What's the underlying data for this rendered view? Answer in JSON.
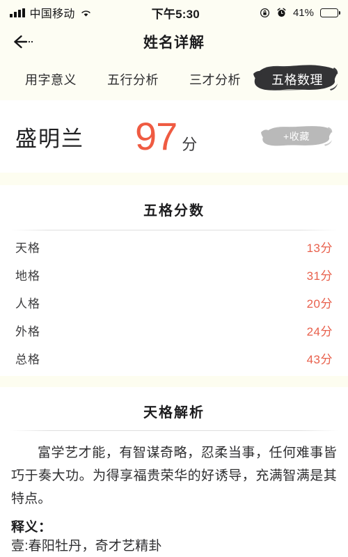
{
  "status_bar": {
    "carrier": "中国移动",
    "signal_icon": "signal-bars-icon",
    "wifi_icon": "wifi-icon",
    "time": "下午5:30",
    "rotation_lock_icon": "rotation-lock-icon",
    "alarm_icon": "alarm-clock-icon",
    "battery_percent": "41%",
    "battery_icon": "battery-icon",
    "battery_level": 41
  },
  "navbar": {
    "back_icon": "back-arrow-icon",
    "title": "姓名详解"
  },
  "tabs": [
    {
      "label": "用字意义",
      "active": false
    },
    {
      "label": "五行分析",
      "active": false
    },
    {
      "label": "三才分析",
      "active": false
    },
    {
      "label": "五格数理",
      "active": true
    }
  ],
  "headline": {
    "name": "盛明兰",
    "score": "97",
    "score_unit": "分",
    "favorite_label": "+收藏"
  },
  "sections": {
    "scores": {
      "title": "五格分数",
      "rows": [
        {
          "label": "天格",
          "value": "13分"
        },
        {
          "label": "地格",
          "value": "31分"
        },
        {
          "label": "人格",
          "value": "20分"
        },
        {
          "label": "外格",
          "value": "24分"
        },
        {
          "label": "总格",
          "value": "43分"
        }
      ]
    },
    "analysis": {
      "title": "天格解析",
      "paragraph": "富学艺才能，有智谋奇略，忍柔当事，任何难事皆巧于奏大功。为得享福贵荣华的好诱导，充满智满是其特点。",
      "definition_title": "释义：",
      "definition_items": [
        "壹:春阳牡丹，奇才艺精卦"
      ]
    }
  },
  "colors": {
    "accent_score": "#ef5b42",
    "accent_value": "#e8604c",
    "header_bg": "#fdfdf3",
    "band_bg": "#fdfdf0",
    "active_tab_bg": "#333335"
  }
}
